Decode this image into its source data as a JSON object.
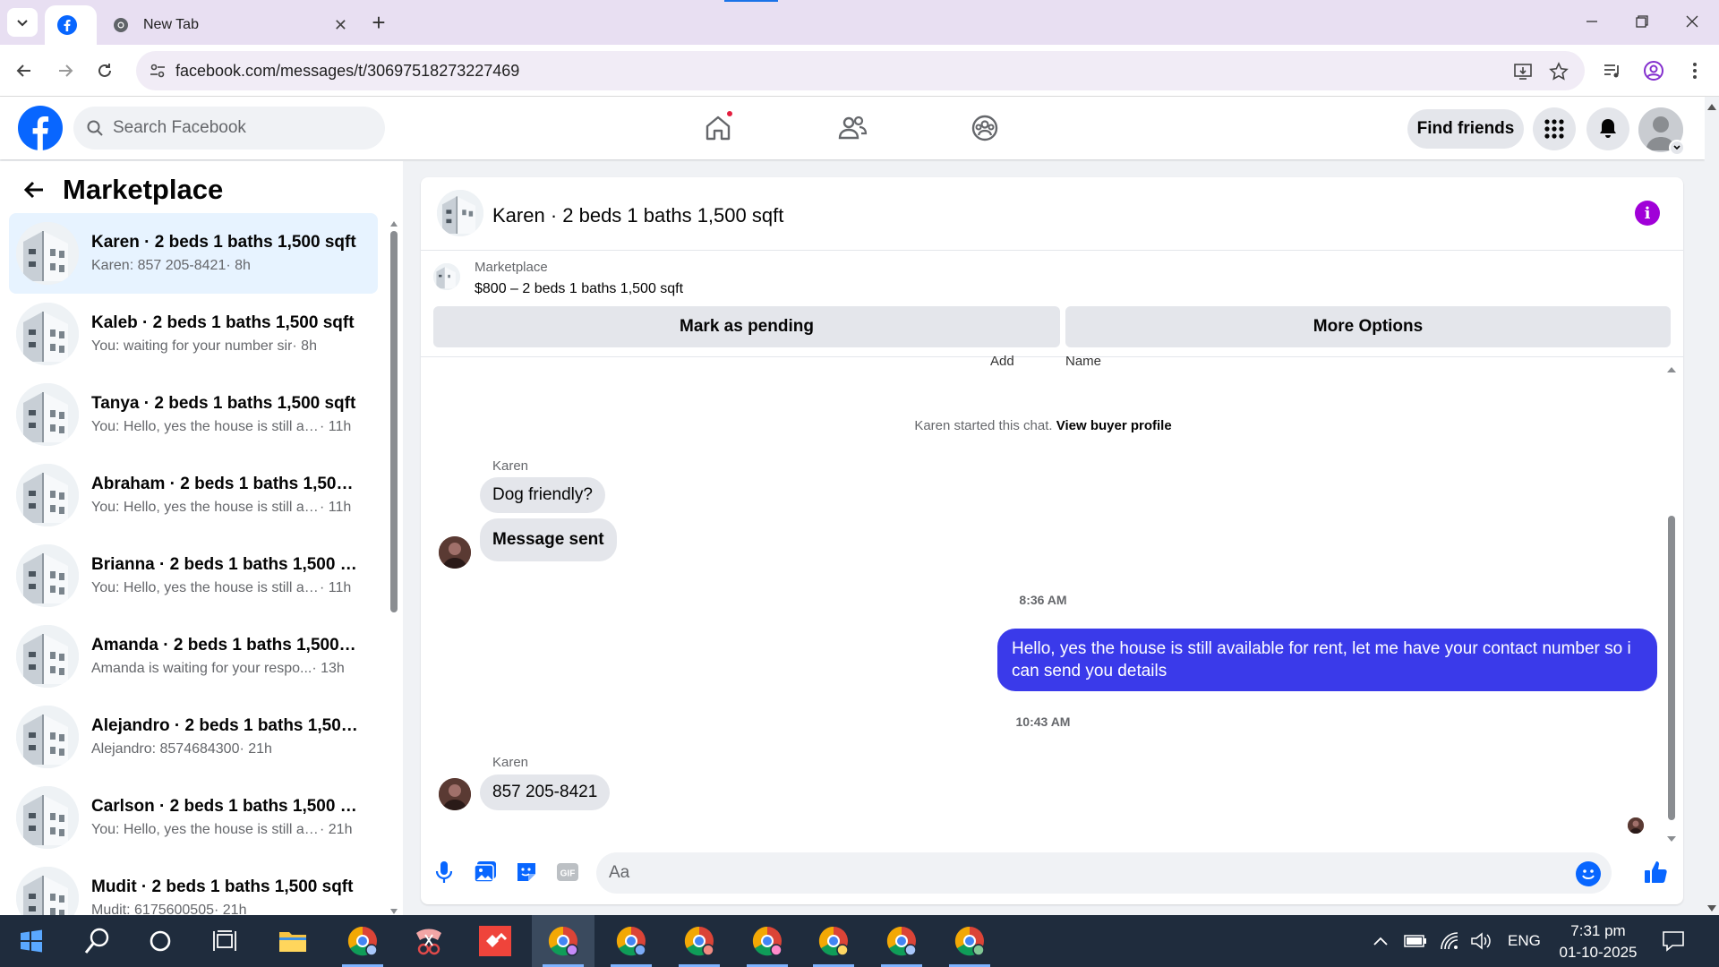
{
  "browser": {
    "tabs": [
      {
        "title": "",
        "icon": "facebook-icon",
        "active": true
      },
      {
        "title": "New Tab",
        "icon": "chrome-icon",
        "active": false
      }
    ],
    "new_tab_symbol": "+",
    "url": "facebook.com/messages/t/30697518273227469"
  },
  "fb": {
    "search_placeholder": "Search Facebook",
    "find_friends": "Find friends",
    "colors": {
      "brand": "#0866ff",
      "outgoing_bubble": "#3a3aea",
      "info_button": "#a000d8",
      "selected_chat": "#e7f3ff"
    }
  },
  "left": {
    "title": "Marketplace",
    "chats": [
      {
        "name": "Karen · 2 beds 1 baths 1,500 sqft",
        "preview": "Karen: 857 205-8421",
        "time": " · 8h",
        "selected": true
      },
      {
        "name": "Kaleb · 2 beds 1 baths 1,500 sqft",
        "preview": "You: waiting for your number sir",
        "time": " · 8h"
      },
      {
        "name": "Tanya · 2 beds 1 baths 1,500 sqft",
        "preview": "You: Hello, yes the house is still av...",
        "time": " · 11h"
      },
      {
        "name": "Abraham · 2 beds 1 baths 1,500 s...",
        "preview": "You: Hello, yes the house is still av...",
        "time": " · 11h"
      },
      {
        "name": "Brianna · 2 beds 1 baths 1,500 sqft",
        "preview": "You: Hello, yes the house is still av...",
        "time": " · 11h"
      },
      {
        "name": "Amanda · 2 beds 1 baths 1,500 s...",
        "preview": "Amanda is waiting for your respo...",
        "time": " · 13h"
      },
      {
        "name": "Alejandro · 2 beds 1 baths 1,500 ...",
        "preview": "Alejandro: 8574684300",
        "time": " · 21h"
      },
      {
        "name": "Carlson · 2 beds 1 baths 1,500 sqft",
        "preview": "You: Hello, yes the house is still av...",
        "time": " · 21h"
      },
      {
        "name": "Mudit · 2 beds 1 baths 1,500 sqft",
        "preview": "Mudit: 6175600505",
        "time": " · 21h"
      }
    ]
  },
  "conv": {
    "title": "Karen · 2 beds 1 baths 1,500 sqft",
    "info_symbol": "i",
    "listing_label": "Marketplace",
    "listing_price": "$800 – 2 beds 1 baths 1,500 sqft",
    "mark_pending": "Mark as pending",
    "more_options": "More Options",
    "cut_add": "Add",
    "cut_name": "Name",
    "started_text": "Karen started this chat. ",
    "view_buyer": "View buyer profile",
    "sender": "Karen",
    "msg1": "Dog friendly?",
    "msg2": "Message sent",
    "time1": "8:36 AM",
    "outgoing": "Hello, yes the house is still available for rent, let me have your contact number so i can send you  details",
    "time2": "10:43 AM",
    "msg3": "857 205-8421",
    "composer_placeholder": "Aa"
  },
  "taskbar": {
    "language": "ENG",
    "time": "7:31 pm",
    "date": "01-10-2025"
  }
}
